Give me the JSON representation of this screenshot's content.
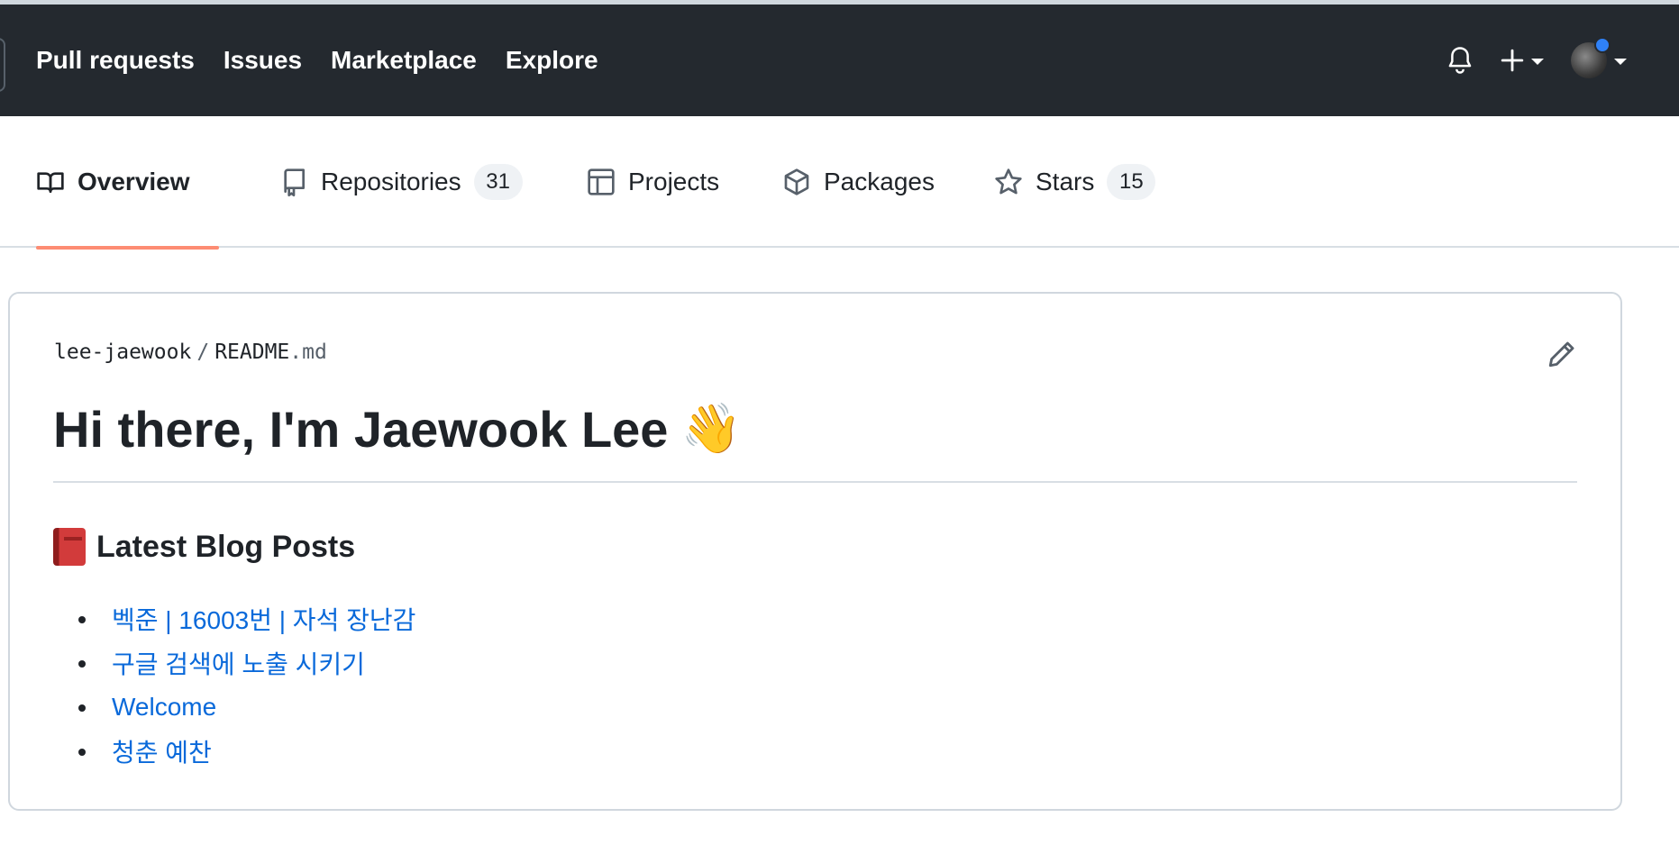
{
  "header": {
    "nav": [
      {
        "label": "Pull requests"
      },
      {
        "label": "Issues"
      },
      {
        "label": "Marketplace"
      },
      {
        "label": "Explore"
      }
    ],
    "icons": {
      "notifications": "bell-icon",
      "create": "plus-icon",
      "profile": "avatar"
    }
  },
  "tabs": [
    {
      "label": "Overview",
      "icon": "book-icon",
      "selected": true
    },
    {
      "label": "Repositories",
      "icon": "repo-icon",
      "count": "31"
    },
    {
      "label": "Projects",
      "icon": "table-icon"
    },
    {
      "label": "Packages",
      "icon": "package-icon"
    },
    {
      "label": "Stars",
      "icon": "star-icon",
      "count": "15"
    }
  ],
  "readme": {
    "owner": "lee-jaewook",
    "separator": "/",
    "file_base": "README",
    "file_ext": ".md",
    "title": "Hi there, I'm Jaewook Lee",
    "title_emoji": "👋",
    "section_heading": "Latest Blog Posts",
    "posts": [
      "벡준 | 16003번 | 자석 장난감",
      "구글 검색에 노출 시키기",
      "Welcome",
      "청춘 예찬"
    ]
  },
  "colors": {
    "header_bg": "#24292f",
    "tab_underline": "#fd8c73",
    "link": "#0969da",
    "notification_dot": "#2f81f7"
  }
}
